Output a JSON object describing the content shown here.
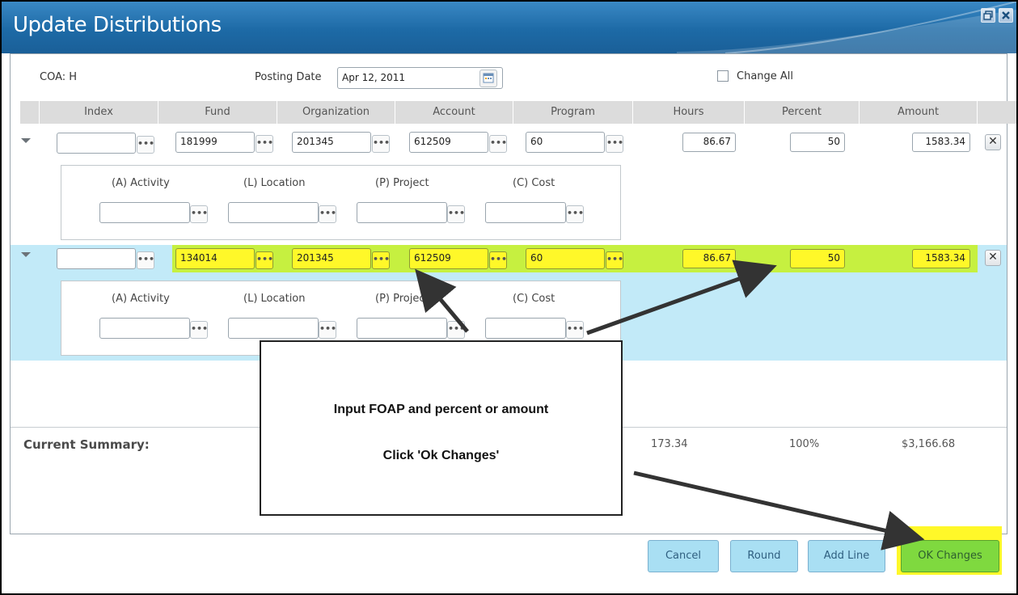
{
  "window": {
    "title": "Update Distributions",
    "restore_icon": "restore-window-icon",
    "close_icon": "close-window-icon"
  },
  "header": {
    "coa_label": "COA: H",
    "posting_date_label": "Posting Date",
    "posting_date_value": "Apr 12, 2011",
    "change_all_label": "Change All",
    "change_all_checked": false
  },
  "columns": [
    "Index",
    "Fund",
    "Organization",
    "Account",
    "Program",
    "Hours",
    "Percent",
    "Amount"
  ],
  "sub_columns": [
    "(A) Activity",
    "(L) Location",
    "(P) Project",
    "(C) Cost"
  ],
  "lookup_button_label": "•••",
  "rows": [
    {
      "index": "",
      "fund": "181999",
      "organization": "201345",
      "account": "612509",
      "program": "60",
      "hours": "86.67",
      "percent": "50",
      "amount": "1583.34",
      "highlighted": false,
      "activity": "",
      "location": "",
      "project": "",
      "cost": ""
    },
    {
      "index": "",
      "fund": "134014",
      "organization": "201345",
      "account": "612509",
      "program": "60",
      "hours": "86.67",
      "percent": "50",
      "amount": "1583.34",
      "highlighted": true,
      "activity": "",
      "location": "",
      "project": "",
      "cost": ""
    }
  ],
  "delete_label": "✕",
  "summary": {
    "label": "Current Summary:",
    "hours": "173.34",
    "percent": "100%",
    "amount": "$3,166.68"
  },
  "buttons": {
    "cancel": "Cancel",
    "round": "Round",
    "add_line": "Add Line",
    "ok_changes": "OK Changes"
  },
  "callout": {
    "line1": "Input FOAP and percent or amount",
    "line2": "Click 'Ok Changes'"
  },
  "colors": {
    "title_bar": "#1d6aa6",
    "highlight_row": "#c6f040",
    "highlight_field": "#fff829",
    "selected_row_bg": "#c2eaf8",
    "button_blue": "#a9dff3",
    "button_green": "#7fd93f"
  }
}
